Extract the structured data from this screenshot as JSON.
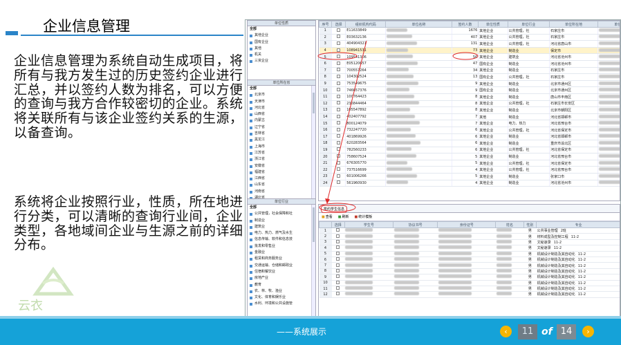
{
  "slide": {
    "title": "企业信息管理",
    "paragraph1": "企业信息管理为系统自动生成项目，将所有与我方发生过的历史签约企业进行汇总，并以签约人数为排名，可以方便的查询与我方合作较密切的企业。系统将关联所有与该企业签约关系的生源，以备查询。",
    "paragraph2": "系统将企业按照行业，性质，所在地进行分类，可以清晰的查询行业间，企业类型，各地域间企业与生源之前的详细分布。",
    "logo_text": "云衣"
  },
  "tree_nature": {
    "header": "单位性质",
    "root": "全部",
    "items": [
      "其他企业",
      "国有企业",
      "其他",
      "机关",
      "三资企业"
    ]
  },
  "tree_location": {
    "header": "单位所在省",
    "root": "全部",
    "items": [
      "北京市",
      "天津市",
      "河北省",
      "山西省",
      "内蒙古",
      "辽宁省",
      "吉林省",
      "黑龙江",
      "上海市",
      "江苏省",
      "浙江省",
      "安徽省",
      "福建省",
      "江西省",
      "山东省",
      "河南省",
      "湖北省",
      "湖南省",
      "广东省",
      "广西",
      "海南省",
      "重庆市",
      "四川省",
      "贵州省",
      "云南省",
      "西藏",
      "陕西省"
    ]
  },
  "tree_industry": {
    "header": "单位行业",
    "root": "全部",
    "items": [
      "公共管理，社会保障和社",
      "制造业",
      "建筑业",
      "电力、热力、燃气及水生",
      "信息传输、软件和信息技",
      "批发和零售业",
      "金融业",
      "租赁和商务服务业",
      "交通运输、仓储和邮政业",
      "住宿和餐饮业",
      "房地产业",
      "教育",
      "农、林、牧、渔业",
      "文化、体育和娱乐业",
      "水利、环境和公共设施管"
    ]
  },
  "main_grid": {
    "columns": [
      "序号",
      "选择",
      "组织机构代码",
      "单位名称",
      "签约人数",
      "单位性质",
      "单位行业",
      "单位所在地",
      "单位地址",
      "单位电话",
      "单位邮编",
      "单"
    ],
    "rows": [
      {
        "n": "1",
        "code": "E11633849",
        "people": "1676",
        "nature": "其他企业",
        "industry": "公共管理，社",
        "loc": "石家庄市",
        "zip": "000"
      },
      {
        "n": "2",
        "code": "E03632136",
        "people": "407",
        "nature": "其他企业",
        "industry": "公共管理，社",
        "loc": "石家庄市",
        "zip": "000"
      },
      {
        "n": "3",
        "code": "404904321",
        "people": "131",
        "nature": "其他企业",
        "industry": "公共管理，社",
        "loc": "河北省唐山市",
        "zip": "000"
      },
      {
        "n": "4",
        "code": "108941531",
        "people": "73",
        "nature": "其他企业",
        "industry": "制造业",
        "loc": "保定市",
        "zip": "000"
      },
      {
        "n": "5",
        "code": "109541306",
        "people": "56",
        "nature": "其他企业",
        "industry": "建筑业",
        "loc": "河北省沧州市",
        "zip": "000"
      },
      {
        "n": "6",
        "code": "E05120657",
        "people": "47",
        "nature": "国有企业",
        "industry": "制造业",
        "loc": "河北省沧州市",
        "zip": "000"
      },
      {
        "n": "7",
        "code": "700557264",
        "people": "34",
        "nature": "其他企业",
        "industry": "制造业",
        "loc": "石家庄市",
        "zip": "011"
      },
      {
        "n": "8",
        "code": "104302524",
        "people": "13",
        "nature": "国有企业",
        "industry": "公共管理，社",
        "loc": "石家庄市",
        "zip": "051"
      },
      {
        "n": "9",
        "code": "753549675",
        "people": "9",
        "nature": "其他企业",
        "industry": "制造业",
        "loc": "北京市通州区",
        "zip": "000"
      },
      {
        "n": "10",
        "code": "746657376",
        "people": "9",
        "nature": "国有企业",
        "industry": "制造业",
        "loc": "北京市通州区",
        "zip": "000"
      },
      {
        "n": "11",
        "code": "100764423",
        "people": "8",
        "nature": "其他企业",
        "industry": "制造业",
        "loc": "唐山市丰南区",
        "zip": "000"
      },
      {
        "n": "12",
        "code": "236844464",
        "people": "8",
        "nature": "其他企业",
        "industry": "公共管理，社",
        "loc": "石家庄市长安区",
        "zip": "000"
      },
      {
        "n": "13",
        "code": "105547892",
        "people": "8",
        "nature": "其他企业",
        "industry": "制造业",
        "loc": "北京市朝阳区",
        "zip": "000"
      },
      {
        "n": "14",
        "code": "402407792",
        "people": "7",
        "nature": "其他",
        "industry": "制造业",
        "loc": "河北省邯郸市",
        "zip": "016"
      },
      {
        "n": "15",
        "code": "800124079",
        "people": "7",
        "nature": "其他企业",
        "industry": "电力、热力",
        "loc": "河北省邢台市",
        "zip": "000"
      },
      {
        "n": "16",
        "code": "732247720",
        "people": "6",
        "nature": "其他企业",
        "industry": "公共管理，社",
        "loc": "河北省保定市",
        "zip": "000"
      },
      {
        "n": "17",
        "code": "401869926",
        "people": "6",
        "nature": "其他企业",
        "industry": "制造业",
        "loc": "河北省邯郸市",
        "zip": "000"
      },
      {
        "n": "18",
        "code": "620283564",
        "people": "6",
        "nature": "其他企业",
        "industry": "制造业",
        "loc": "重庆市渝北区",
        "zip": "101"
      },
      {
        "n": "19",
        "code": "782560233",
        "people": "6",
        "nature": "其他企业",
        "industry": "公共管理，社",
        "loc": "河北省保定市",
        "zip": "000"
      },
      {
        "n": "20",
        "code": "758607524",
        "people": "5",
        "nature": "其他企业",
        "industry": "制造业",
        "loc": "河北省邢台市",
        "zip": "000"
      },
      {
        "n": "21",
        "code": "676305770",
        "people": "5",
        "nature": "其他企业",
        "industry": "公共管理，社",
        "loc": "河北省保定市",
        "zip": "000"
      },
      {
        "n": "22",
        "code": "737516699",
        "people": "4",
        "nature": "其他企业",
        "industry": "公共管理，社",
        "loc": "河北省邢台市",
        "zip": "000"
      },
      {
        "n": "23",
        "code": "601006266",
        "people": "5",
        "nature": "其他企业",
        "industry": "制造业",
        "loc": "张家口市",
        "zip": "000"
      },
      {
        "n": "24",
        "code": "561960930",
        "people": "4",
        "nature": "其他企业",
        "industry": "制造业",
        "loc": "河北省沧州市",
        "zip": "000"
      }
    ]
  },
  "sub_grid": {
    "tab_label": "签约学生信息",
    "toolbar": [
      "查看",
      "刷新",
      "统计模板"
    ],
    "columns": [
      "选择",
      "学生号",
      "协议书号",
      "身份证号",
      "姓名",
      "性别",
      "专业"
    ],
    "gender": "男",
    "majors": [
      "公共事业管理",
      "材料成型及控制工程",
      "文秘速录",
      "文秘速录",
      "机械设计制造及其自动化",
      "机械设计制造及其自动化",
      "机械设计制造及其自动化",
      "机械设计制造及其自动化",
      "机械设计制造及其自动化",
      "机械设计制造及其自动化",
      "机械设计制造及其自动化",
      "机械设计制造及其自动化"
    ],
    "codes": [
      "2班",
      "11-2",
      "11-2",
      "11-2",
      "11-2",
      "11-2",
      "11-2",
      "11-2",
      "11-2",
      "11-2",
      "11-2",
      "11-2"
    ]
  },
  "footer": {
    "label": "——系统展示",
    "current_page": "11",
    "of_label": "of",
    "total_pages": "14",
    "prev_icon": "‹",
    "next_icon": "›"
  }
}
